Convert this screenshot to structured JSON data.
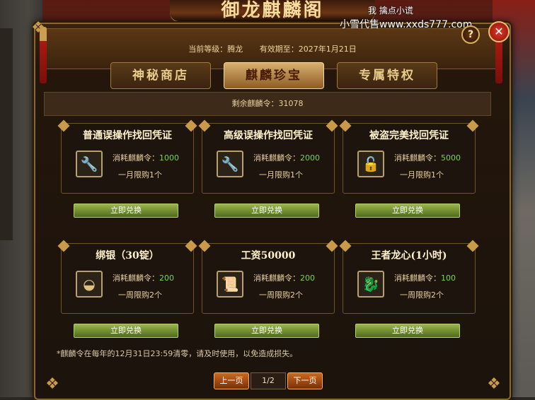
{
  "banner": {
    "title": "御龙麒麟阁",
    "scroll_text": "我 擒点小谎"
  },
  "watermark": "小雪代售www.xxds777.com",
  "header": {
    "level_label": "当前等级：腾龙",
    "expiry_label": "有效期至：2027年1月21日"
  },
  "controls": {
    "help": "?",
    "close": "✕"
  },
  "tabs": [
    {
      "label": "神秘商店",
      "active": false
    },
    {
      "label": "麒麟珍宝",
      "active": true
    },
    {
      "label": "专属特权",
      "active": false
    }
  ],
  "remaining": "剩余麒麟令：31078",
  "cost_prefix": "消耗麒麟令：",
  "items": [
    {
      "title": "普通误操作找回凭证",
      "icon": "wrench-icon",
      "cost": "1000",
      "limit": "一月限购1个",
      "button": "立即兑换"
    },
    {
      "title": "高级误操作找回凭证",
      "icon": "wrench-icon",
      "cost": "2000",
      "limit": "一月限购1个",
      "button": "立即兑换"
    },
    {
      "title": "被盗完美找回凭证",
      "icon": "lock-icon",
      "cost": "5000",
      "limit": "一月限购1个",
      "button": "立即兑换"
    },
    {
      "title": "绑银（30锭）",
      "icon": "silver-ingot-icon",
      "cost": "200",
      "limit": "一周限购2个",
      "button": "立即兑换"
    },
    {
      "title": "工资50000",
      "icon": "gold-scroll-icon",
      "cost": "200",
      "limit": "一周限购2个",
      "button": "立即兑换"
    },
    {
      "title": "王者龙心(1小时)",
      "icon": "dragon-icon",
      "cost": "100",
      "limit": "一周限购2个",
      "button": "立即兑换"
    }
  ],
  "note": "*麒麟令在每年的12月31日23:59清零，请及时使用，以免造成损失。",
  "pager": {
    "prev": "上一页",
    "page": "1/2",
    "next": "下一页"
  },
  "colors": {
    "accent_gold": "#c89a4a",
    "cost_green": "#7dd34a",
    "button_green": "#7a9a32",
    "close_red": "#c82418"
  }
}
